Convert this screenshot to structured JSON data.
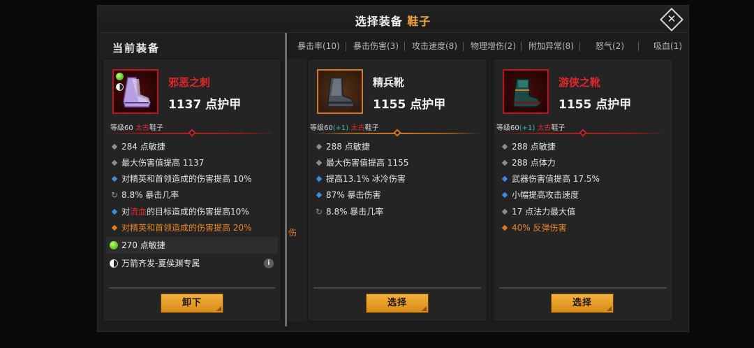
{
  "dialog": {
    "title_prefix": "选择装备 ",
    "title_highlight": "鞋子"
  },
  "current_section": {
    "label": "当前装备"
  },
  "filter_tabs": [
    {
      "label": "暴击率(10)"
    },
    {
      "label": "暴击伤害(3)"
    },
    {
      "label": "攻击速度(8)"
    },
    {
      "label": "物理增伤(2)"
    },
    {
      "label": "附加异常(8)"
    },
    {
      "label": "怒气(2)"
    },
    {
      "label": "吸血(1)"
    }
  ],
  "peek_text": "伤",
  "current_item": {
    "name": "邪恶之刺",
    "armor": "1137 点护甲",
    "level_prefix": "等级60 ",
    "rarity": "太古",
    "slot": "鞋子",
    "stats": [
      {
        "bullet": "grey",
        "text": "284 点敏捷"
      },
      {
        "bullet": "grey",
        "text": "最大伤害值提高 1137"
      },
      {
        "bullet": "blue",
        "text": "对精英和首领造成的伤害提高 10%"
      },
      {
        "bullet": "cycle",
        "text": "8.8% 暴击几率"
      },
      {
        "bullet": "blue",
        "text_before": "对",
        "text_red": "流血",
        "text_after": "的目标造成的伤害提高10%"
      },
      {
        "bullet": "orange",
        "text": "对精英和首领造成的伤害提高 20%"
      }
    ],
    "gem": "270 点敏捷",
    "set_name": "万箭齐发-夏侯渊专属",
    "info_icon_text": "i",
    "button_label": "卸下"
  },
  "candidates": [
    {
      "name": "精兵靴",
      "armor": "1155 点护甲",
      "level_prefix": "等级60",
      "plus": "(+1)",
      "rarity": "太古",
      "slot": "鞋子",
      "stats": [
        {
          "bullet": "grey",
          "text": "288 点敏捷"
        },
        {
          "bullet": "grey",
          "text": "最大伤害值提高 1155"
        },
        {
          "bullet": "blue",
          "text": "提高13.1% 冰冷伤害"
        },
        {
          "bullet": "blue",
          "text": "87% 暴击伤害"
        },
        {
          "bullet": "cycle",
          "text": "8.8% 暴击几率"
        }
      ],
      "button_label": "选择"
    },
    {
      "name": "游侠之靴",
      "armor": "1155 点护甲",
      "level_prefix": "等级60",
      "plus": "(+1) ",
      "rarity": "太古",
      "slot": "鞋子",
      "stats": [
        {
          "bullet": "grey",
          "text": "288 点敏捷"
        },
        {
          "bullet": "grey",
          "text": "288 点体力"
        },
        {
          "bullet": "blue",
          "text": "武器伤害值提高 17.5%"
        },
        {
          "bullet": "blue",
          "text": "小幅提高攻击速度"
        },
        {
          "bullet": "grey",
          "text": "17 点法力最大值"
        },
        {
          "bullet": "orange",
          "text": "40% 反弹伤害"
        }
      ],
      "button_label": "选择"
    }
  ],
  "colors": {
    "accent_orange": "#f0a63a",
    "legendary_red": "#e2262a",
    "ancestral_plus": "#3fbba8",
    "button": "#e89e28"
  }
}
